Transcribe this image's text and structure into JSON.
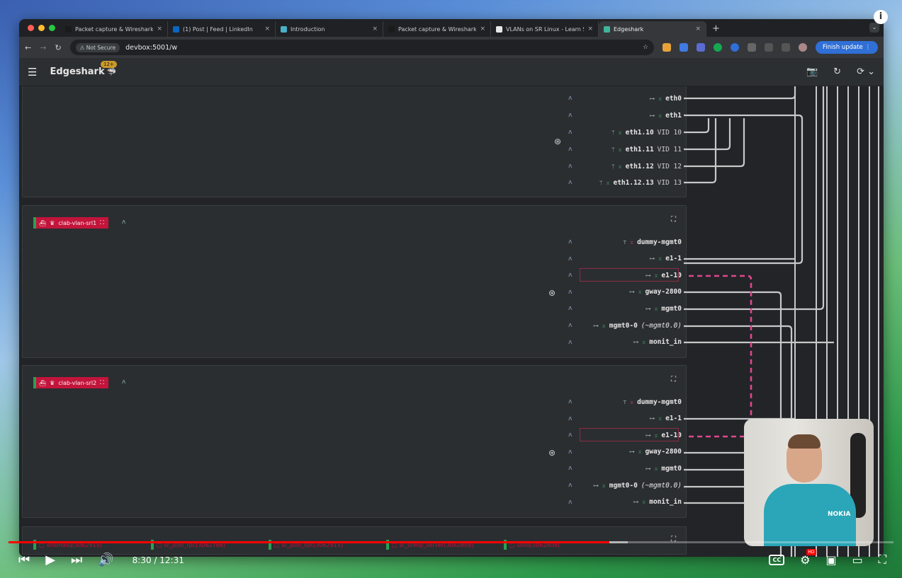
{
  "browser": {
    "tabs": [
      {
        "label": "Packet capture & Wireshark -",
        "icon": "containerlab-icon",
        "color": "#1a1a1a",
        "active": false
      },
      {
        "label": "(1) Post | Feed | LinkedIn",
        "icon": "linkedin-icon",
        "color": "#0a66c2",
        "active": false
      },
      {
        "label": "Introduction",
        "icon": "bird-icon",
        "color": "#4bb0c7",
        "active": false
      },
      {
        "label": "Packet capture & Wireshark -",
        "icon": "containerlab-icon",
        "color": "#1a1a1a",
        "active": false
      },
      {
        "label": "VLANs on SR Linux - Learn SR",
        "icon": "srlinux-icon",
        "color": "#e8e8e8",
        "active": false
      },
      {
        "label": "Edgeshark",
        "icon": "edgeshark-icon",
        "color": "#3fb59a",
        "active": true
      }
    ],
    "new_tab": "+",
    "not_secure": "Not Secure",
    "url": "devbox:5001/w",
    "finish_update": "Finish update"
  },
  "app": {
    "name": "Edgeshark",
    "version_badge": "12+"
  },
  "panels": {
    "top": {
      "interfaces": [
        {
          "name": "eth0",
          "vid": ""
        },
        {
          "name": "eth1",
          "vid": ""
        },
        {
          "name": "eth1.10",
          "vid": "VID 10"
        },
        {
          "name": "eth1.11",
          "vid": "VID 11"
        },
        {
          "name": "eth1.12",
          "vid": "VID 12"
        },
        {
          "name": "eth1.12.13",
          "vid": "VID 13"
        }
      ]
    },
    "srl1": {
      "label": "clab-vlan-srl1",
      "interfaces": [
        {
          "name": "dummy-mgmt0"
        },
        {
          "name": "e1-1"
        },
        {
          "name": "e1-10"
        },
        {
          "name": "gway-2800"
        },
        {
          "name": "mgmt0"
        },
        {
          "name": "mgmt0-0",
          "alias": "(~mgmt0.0)"
        },
        {
          "name": "monit_in"
        }
      ]
    },
    "srl2": {
      "label": "clab-vlan-srl2",
      "interfaces": [
        {
          "name": "dummy-mgmt0"
        },
        {
          "name": "e1-1"
        },
        {
          "name": "e1-10"
        },
        {
          "name": "gway-2800"
        },
        {
          "name": "mgmt0"
        },
        {
          "name": "mgmt0-0",
          "alias": "(~mgmt0.0)"
        },
        {
          "name": "monit_in"
        }
      ]
    },
    "bottom_chips": [
      "dnsmasq(3062915)",
      "sr_json_rpc(3062766)",
      "sr_json_rpc(3062915)",
      "sr_snmp_server(3062809)",
      "sshd(3062809)"
    ]
  },
  "video": {
    "time": "8:30 / 12:31",
    "progress_fraction": 0.679,
    "shirt_logo": "NOKIA",
    "hd_badge": "HD",
    "cc_label": "CC"
  },
  "colors": {
    "accent_red": "#c3143b",
    "wire_pink": "#e0468f",
    "wire_gray": "#c8c8c8"
  }
}
